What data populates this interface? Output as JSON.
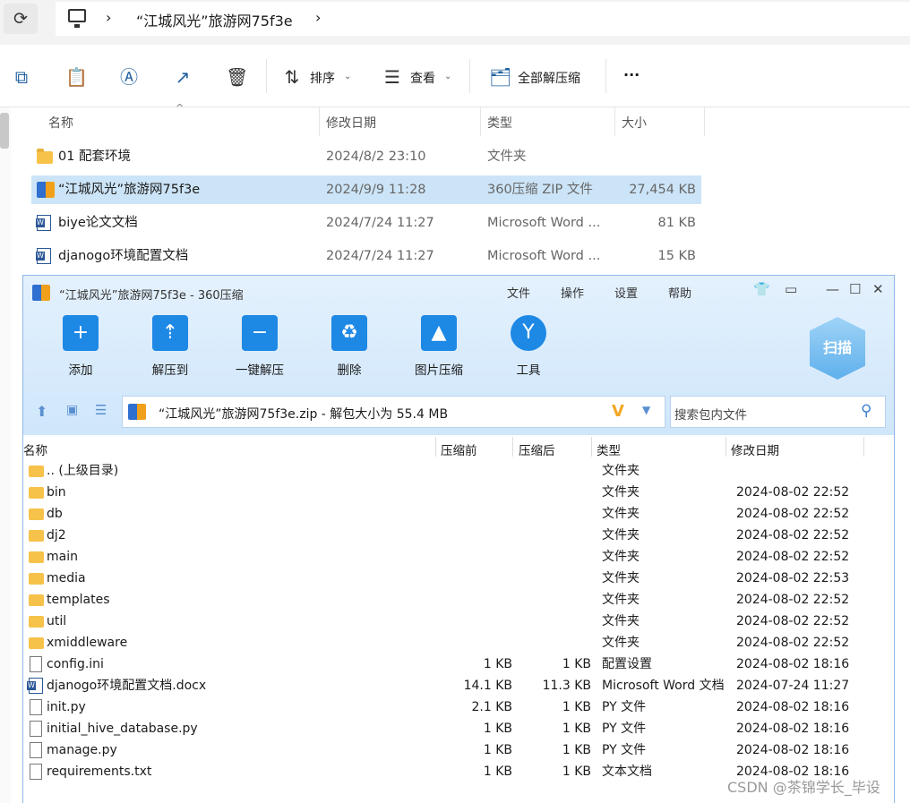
{
  "explorer": {
    "breadcrumb_sep": "›",
    "folder_crumb": "“江城风光”旅游网75f3e",
    "toolbar": {
      "sort_label": "排序",
      "view_label": "查看",
      "extract_all_label": "全部解压缩",
      "more_label": "···"
    },
    "columns": [
      "名称",
      "修改日期",
      "类型",
      "大小"
    ],
    "files": [
      {
        "name": "01 配套环境",
        "date": "2024/8/2 23:10",
        "type": "文件夹",
        "size": "",
        "icon": "folder-icon"
      },
      {
        "name": "“江城风光”旅游网75f3e",
        "date": "2024/9/9 11:28",
        "type": "360压缩 ZIP 文件",
        "size": "27,454 KB",
        "icon": "zip-icon",
        "selected": true
      },
      {
        "name": "biye论文文档",
        "date": "2024/7/24 11:27",
        "type": "Microsoft Word ...",
        "size": "81 KB",
        "icon": "word-doc-icon"
      },
      {
        "name": "djanogo环境配置文档",
        "date": "2024/7/24 11:27",
        "type": "Microsoft Word ...",
        "size": "15 KB",
        "icon": "word-doc-icon"
      }
    ]
  },
  "zipwin": {
    "title": "“江城风光”旅游网75f3e - 360压缩",
    "menu": [
      "文件",
      "操作",
      "设置",
      "帮助"
    ],
    "buttons": [
      "添加",
      "解压到",
      "一键解压",
      "删除",
      "图片压缩",
      "工具"
    ],
    "scan_label": "扫描",
    "path": "“江城风光”旅游网75f3e.zip - 解包大小为 55.4 MB",
    "search_placeholder": "搜索包内文件",
    "columns": [
      "名称",
      "压缩前",
      "压缩后",
      "类型",
      "修改日期"
    ],
    "rows": [
      {
        "name": ".. (上级目录)",
        "before": "",
        "after": "",
        "type": "文件夹",
        "date": "",
        "icon": "folder"
      },
      {
        "name": "bin",
        "before": "",
        "after": "",
        "type": "文件夹",
        "date": "2024-08-02 22:52",
        "icon": "folder"
      },
      {
        "name": "db",
        "before": "",
        "after": "",
        "type": "文件夹",
        "date": "2024-08-02 22:52",
        "icon": "folder"
      },
      {
        "name": "dj2",
        "before": "",
        "after": "",
        "type": "文件夹",
        "date": "2024-08-02 22:52",
        "icon": "folder"
      },
      {
        "name": "main",
        "before": "",
        "after": "",
        "type": "文件夹",
        "date": "2024-08-02 22:52",
        "icon": "folder"
      },
      {
        "name": "media",
        "before": "",
        "after": "",
        "type": "文件夹",
        "date": "2024-08-02 22:53",
        "icon": "folder"
      },
      {
        "name": "templates",
        "before": "",
        "after": "",
        "type": "文件夹",
        "date": "2024-08-02 22:52",
        "icon": "folder"
      },
      {
        "name": "util",
        "before": "",
        "after": "",
        "type": "文件夹",
        "date": "2024-08-02 22:52",
        "icon": "folder"
      },
      {
        "name": "xmiddleware",
        "before": "",
        "after": "",
        "type": "文件夹",
        "date": "2024-08-02 22:52",
        "icon": "folder"
      },
      {
        "name": "config.ini",
        "before": "1 KB",
        "after": "1 KB",
        "type": "配置设置",
        "date": "2024-08-02 18:16",
        "icon": "file"
      },
      {
        "name": "djanogo环境配置文档.docx",
        "before": "14.1 KB",
        "after": "11.3 KB",
        "type": "Microsoft Word 文档",
        "date": "2024-07-24 11:27",
        "icon": "word"
      },
      {
        "name": "init.py",
        "before": "2.1 KB",
        "after": "1 KB",
        "type": "PY 文件",
        "date": "2024-08-02 18:16",
        "icon": "file"
      },
      {
        "name": "initial_hive_database.py",
        "before": "1 KB",
        "after": "1 KB",
        "type": "PY 文件",
        "date": "2024-08-02 18:16",
        "icon": "file"
      },
      {
        "name": "manage.py",
        "before": "1 KB",
        "after": "1 KB",
        "type": "PY 文件",
        "date": "2024-08-02 18:16",
        "icon": "file"
      },
      {
        "name": "requirements.txt",
        "before": "1 KB",
        "after": "1 KB",
        "type": "文本文档",
        "date": "2024-08-02 18:16",
        "icon": "file"
      }
    ]
  },
  "watermark": "CSDN @茶锦学长_毕设"
}
